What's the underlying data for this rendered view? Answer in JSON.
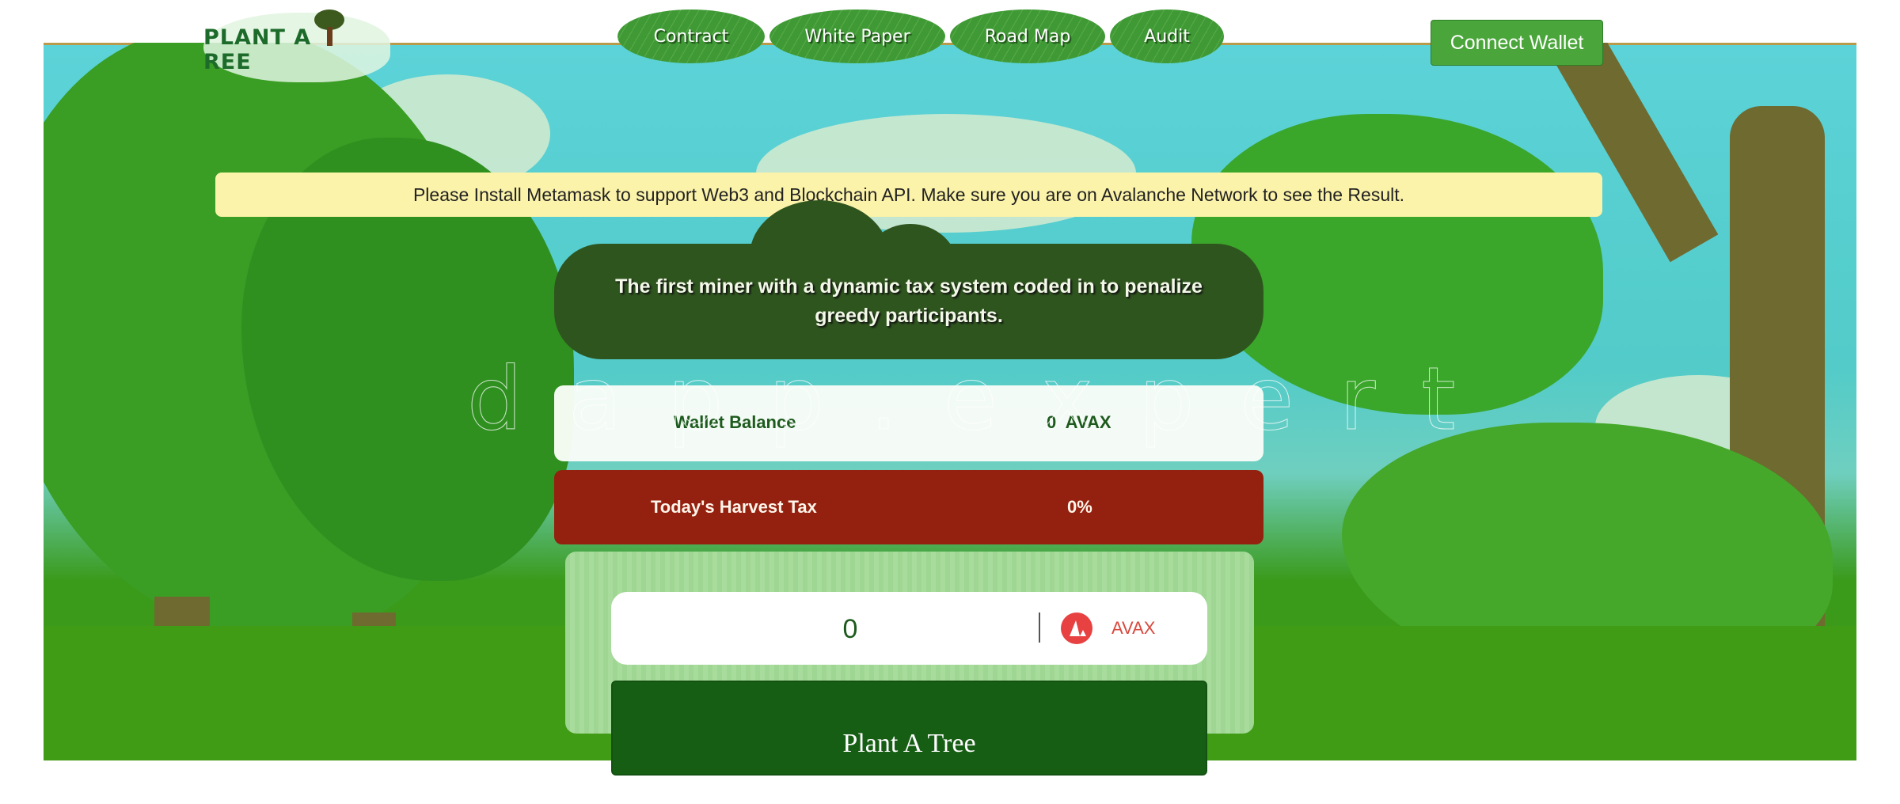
{
  "header": {
    "logo_text_left": "PLANT A",
    "logo_text_right": "REE",
    "nav": [
      {
        "label": "Contract"
      },
      {
        "label": "White Paper"
      },
      {
        "label": "Road Map"
      },
      {
        "label": "Audit"
      }
    ],
    "connect_wallet_label": "Connect Wallet"
  },
  "notice": {
    "text": "Please Install Metamask to support Web3 and Blockchain API. Make sure you are on Avalanche Network to see the Result."
  },
  "hero": {
    "text": "The first miner with a dynamic tax system coded in to penalize greedy participants."
  },
  "watermark": "dapp.expert",
  "wallet_balance": {
    "label": "Wallet Balance",
    "value": "0",
    "unit": "AVAX"
  },
  "harvest_tax": {
    "label": "Today's Harvest Tax",
    "value": "0%"
  },
  "deposit": {
    "amount_value": "0",
    "currency_label": "AVAX",
    "currency_icon": "avax-logo-icon",
    "button_label": "Plant A Tree"
  },
  "colors": {
    "accent_green": "#175e15",
    "tax_red": "#94200f",
    "notice_yellow": "#fbf3a9",
    "avax_red": "#e84142"
  }
}
